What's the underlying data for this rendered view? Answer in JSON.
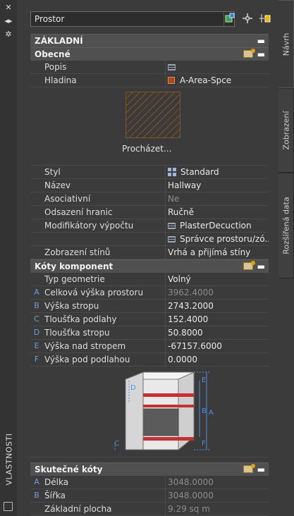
{
  "palette_title": "VLASTNOSTI",
  "toolbar": {
    "object_type": "Prostor"
  },
  "right_tabs": [
    "Návrh",
    "Zobrazení",
    "Rozšířená data"
  ],
  "sections": {
    "basic": {
      "title": "ZÁKLADNÍ",
      "general": {
        "title": "Obecné",
        "rows": [
          {
            "label": "Popis",
            "value": ""
          },
          {
            "label": "Hladina",
            "value": "A-Area-Spce",
            "color": "#b04a10"
          }
        ],
        "browse_label": "Procházet...",
        "rows2": [
          {
            "label": "Styl",
            "value": "Standard"
          },
          {
            "label": "Název",
            "value": "Hallway"
          },
          {
            "label": "Asociativní",
            "value": "Ne"
          },
          {
            "label": "Odsazení hranic",
            "value": "Ručně"
          },
          {
            "label": "Modifikátory výpočtu",
            "value": "PlasterDecuction"
          },
          {
            "label": "",
            "value": "Správce  prostoru/zó..."
          },
          {
            "label": "Zobrazení stínů",
            "value": "Vrhá a přijímá stíny"
          }
        ]
      }
    },
    "components": {
      "title": "Kóty komponent",
      "rows": [
        {
          "letter": "",
          "label": "Typ geometrie",
          "value": "Volný"
        },
        {
          "letter": "A",
          "label": "Celková výška prostoru",
          "value": "3962.4000"
        },
        {
          "letter": "B",
          "label": "Výška stropu",
          "value": "2743.2000"
        },
        {
          "letter": "C",
          "label": "Tloušťka podlahy",
          "value": "152.4000"
        },
        {
          "letter": "D",
          "label": "Tloušťka stropu",
          "value": "50.8000"
        },
        {
          "letter": "E",
          "label": "Výška nad stropem",
          "value": "-67157.6000"
        },
        {
          "letter": "F",
          "label": "Výška pod podlahou",
          "value": "0.0000"
        }
      ],
      "diagram_letters": [
        "D",
        "E",
        "C",
        "F",
        "B",
        "A"
      ]
    },
    "actual": {
      "title": "Skutečné kóty",
      "rows": [
        {
          "letter": "A",
          "label": "Délka",
          "value": "3048.0000"
        },
        {
          "letter": "B",
          "label": "Šířka",
          "value": "3048.0000"
        },
        {
          "letter": "",
          "label": "Základní plocha",
          "value": "9.29 sq m"
        }
      ]
    }
  },
  "icons": {
    "dropdown_arrow": "chevron-down-icon",
    "quick_select": "quick-select-icon",
    "pick": "crosshair-icon",
    "filter": "select-objects-icon"
  },
  "colors": {
    "background": "#3b3b3b",
    "header": "#505050",
    "letter": "#6f9fd8",
    "layer": "#b04a10",
    "hatch": "#8c5a1c"
  }
}
